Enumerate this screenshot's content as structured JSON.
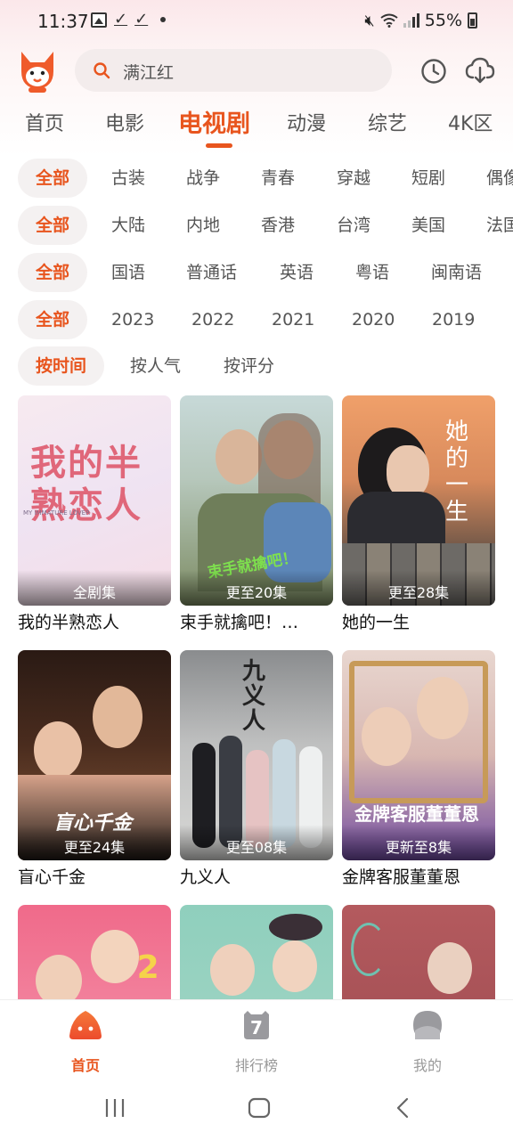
{
  "status_bar": {
    "time": "11:37",
    "battery": "55%"
  },
  "header": {
    "search_text": "满江红",
    "icons": [
      "app-logo",
      "search-icon",
      "history-icon",
      "download-icon"
    ]
  },
  "tabs": [
    {
      "label": "首页",
      "active": false
    },
    {
      "label": "电影",
      "active": false
    },
    {
      "label": "电视剧",
      "active": true
    },
    {
      "label": "动漫",
      "active": false
    },
    {
      "label": "综艺",
      "active": false
    },
    {
      "label": "4K区",
      "active": false
    }
  ],
  "filters": {
    "genre": {
      "active": "全部",
      "items": [
        "古装",
        "战争",
        "青春",
        "穿越",
        "短剧",
        "偶像"
      ]
    },
    "region": {
      "active": "全部",
      "items": [
        "大陆",
        "内地",
        "香港",
        "台湾",
        "美国",
        "法国"
      ]
    },
    "language": {
      "active": "全部",
      "items": [
        "国语",
        "普通话",
        "英语",
        "粤语",
        "闽南语"
      ]
    },
    "year": {
      "active": "全部",
      "items": [
        "2023",
        "2022",
        "2021",
        "2020",
        "2019"
      ]
    },
    "sort": {
      "active": "按时间",
      "items": [
        "按人气",
        "按评分"
      ]
    }
  },
  "shows": [
    {
      "title": "我的半熟恋人",
      "badge": "全剧集",
      "poster_text": "我的半熟恋人",
      "poster_sub": "MY IMMATURE LOVER"
    },
    {
      "title": "束手就擒吧！…",
      "badge": "更至20集",
      "poster_text": "束手就擒吧！"
    },
    {
      "title": "她的一生",
      "badge": "更至28集",
      "poster_text": "她的一生"
    },
    {
      "title": "盲心千金",
      "badge": "更至24集",
      "poster_text": "盲心千金"
    },
    {
      "title": "九义人",
      "badge": "更至08集",
      "poster_text": "九义人"
    },
    {
      "title": "金牌客服董董恩",
      "badge": "更新至8集",
      "poster_text": "金牌客服董董恩"
    },
    {
      "title": "",
      "badge": "",
      "poster_text": "1 2"
    },
    {
      "title": "",
      "badge": "",
      "poster_text": ""
    },
    {
      "title": "",
      "badge": "",
      "poster_text": ""
    }
  ],
  "bottom_nav": [
    {
      "label": "首页",
      "active": true,
      "icon": "home-icon"
    },
    {
      "label": "排行榜",
      "active": false,
      "icon": "ranking-icon"
    },
    {
      "label": "我的",
      "active": false,
      "icon": "profile-icon"
    }
  ],
  "colors": {
    "accent": "#e8551e",
    "chip_bg": "#f4f1f1"
  }
}
